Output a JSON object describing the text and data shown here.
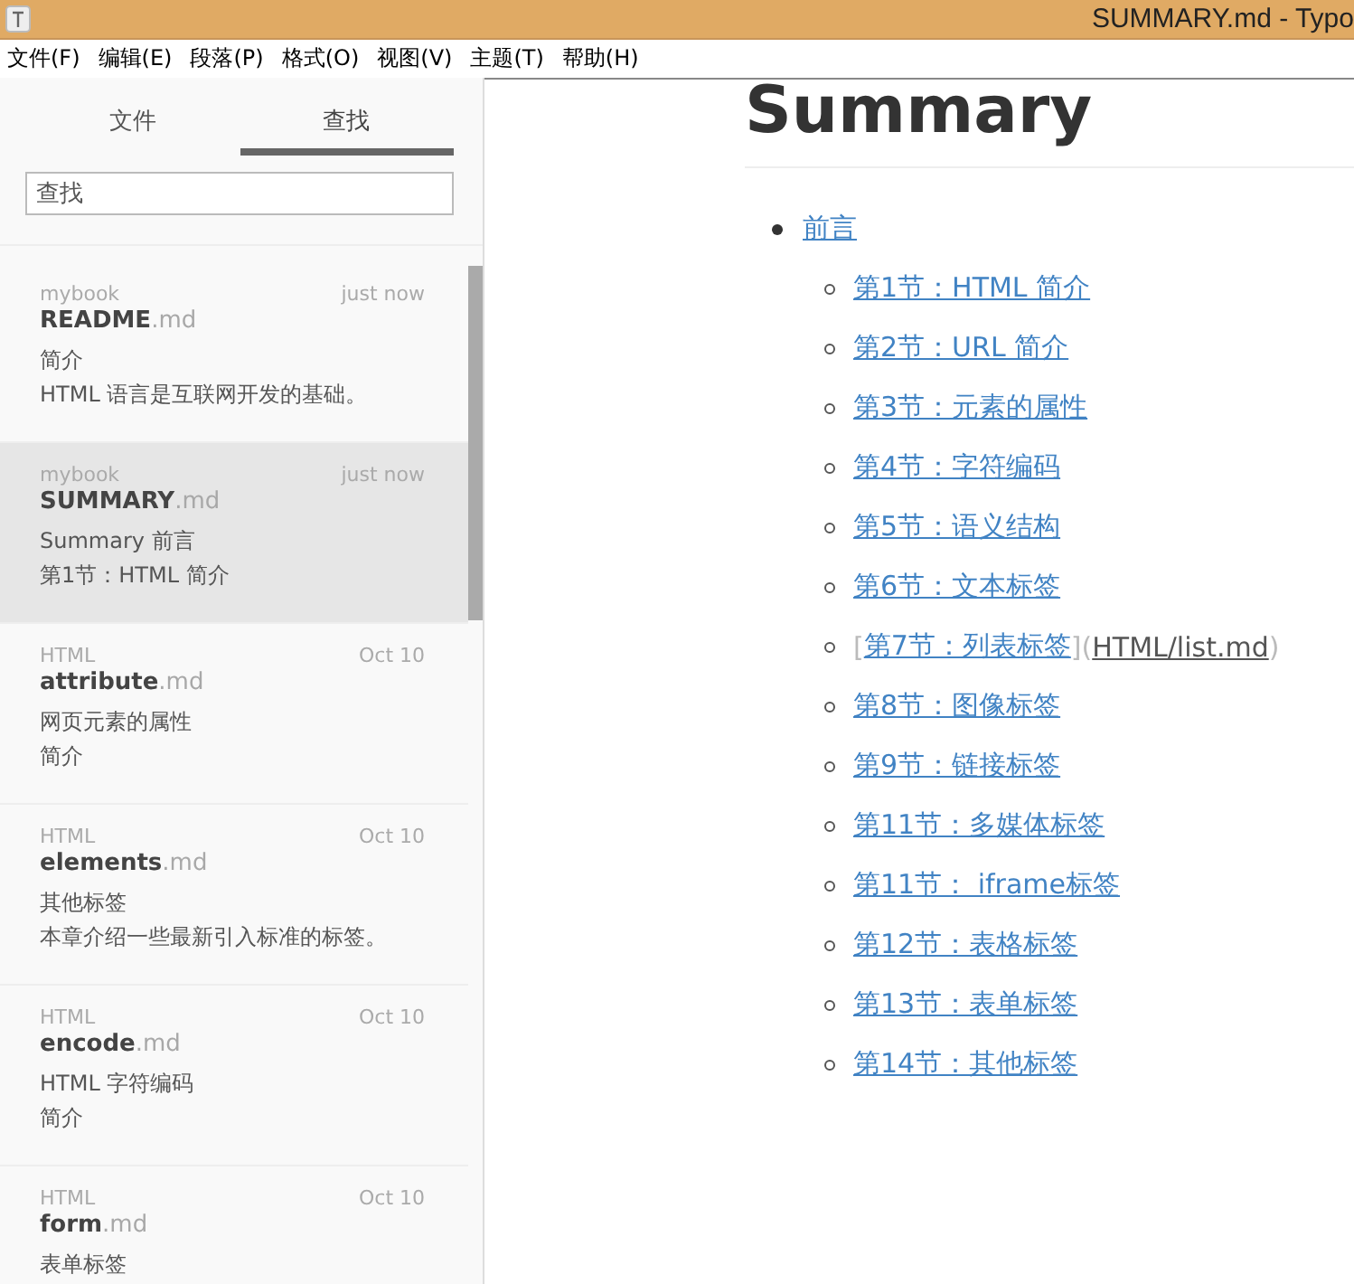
{
  "window": {
    "title": "SUMMARY.md - Typo"
  },
  "menu": [
    "文件(F)",
    "编辑(E)",
    "段落(P)",
    "格式(O)",
    "视图(V)",
    "主题(T)",
    "帮助(H)"
  ],
  "sidebar": {
    "tabs": [
      {
        "label": "文件",
        "selected": false
      },
      {
        "label": "查找",
        "selected": true
      }
    ],
    "search": {
      "value": "查找"
    },
    "files": [
      {
        "folder": "mybook",
        "time": "just now",
        "name": "README",
        "ext": ".md",
        "lines": [
          "简介",
          "HTML 语言是互联网开发的基础。"
        ],
        "selected": false
      },
      {
        "folder": "mybook",
        "time": "just now",
        "name": "SUMMARY",
        "ext": ".md",
        "lines": [
          "Summary 前言",
          "第1节：HTML 简介"
        ],
        "selected": true
      },
      {
        "folder": "HTML",
        "time": "Oct 10",
        "name": "attribute",
        "ext": ".md",
        "lines": [
          "网页元素的属性",
          "简介"
        ],
        "selected": false
      },
      {
        "folder": "HTML",
        "time": "Oct 10",
        "name": "elements",
        "ext": ".md",
        "lines": [
          "其他标签",
          "本章介绍一些最新引入标准的标签。"
        ],
        "selected": false
      },
      {
        "folder": "HTML",
        "time": "Oct 10",
        "name": "encode",
        "ext": ".md",
        "lines": [
          "HTML 字符编码",
          "简介"
        ],
        "selected": false
      },
      {
        "folder": "HTML",
        "time": "Oct 10",
        "name": "form",
        "ext": ".md",
        "lines": [
          "表单标签"
        ],
        "selected": false
      }
    ]
  },
  "document": {
    "heading": "Summary",
    "list": [
      {
        "text": "前言",
        "children": [
          {
            "kind": "link",
            "text": "第1节：HTML 简介"
          },
          {
            "kind": "link",
            "text": "第2节：URL 简介"
          },
          {
            "kind": "link",
            "text": "第3节：元素的属性"
          },
          {
            "kind": "link",
            "text": "第4节：字符编码"
          },
          {
            "kind": "link",
            "text": "第5节：语义结构"
          },
          {
            "kind": "link",
            "text": "第6节：文本标签"
          },
          {
            "kind": "raw",
            "open": "[",
            "text": "第7节：列表标签",
            "mid": "](",
            "url": "HTML/list.md",
            "close": ")"
          },
          {
            "kind": "link",
            "text": "第8节：图像标签"
          },
          {
            "kind": "link",
            "text": "第9节：链接标签"
          },
          {
            "kind": "link",
            "text": "第11节：多媒体标签"
          },
          {
            "kind": "link",
            "text": "第11节： iframe标签"
          },
          {
            "kind": "link",
            "text": "第12节：表格标签"
          },
          {
            "kind": "link",
            "text": "第13节：表单标签"
          },
          {
            "kind": "link",
            "text": "第14节：其他标签"
          }
        ]
      }
    ]
  }
}
